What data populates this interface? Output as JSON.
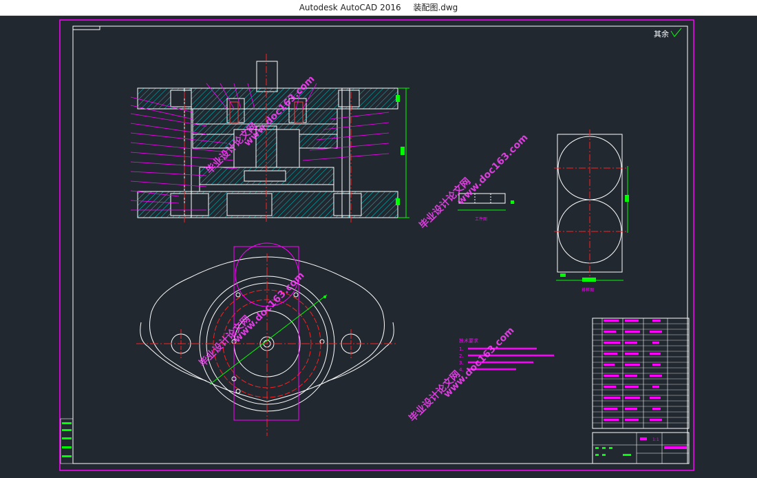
{
  "window": {
    "app_title": "Autodesk AutoCAD 2016",
    "file_name": "装配图.dwg"
  },
  "drawing": {
    "roughness_note": "其余",
    "tech_req_title": "技术要求",
    "tech_req_items": [
      "1.",
      "2.",
      "3.",
      "4."
    ],
    "label_part": "工件图",
    "label_layout": "排样图",
    "scale_text": "1:1",
    "colors": {
      "background": "#212830",
      "frame": "#ff00ff",
      "lines": "#ffffff",
      "hatch": "#00c8c8",
      "center": "#ff2020",
      "dimension": "#00ff00",
      "watermark": "#ff40ff"
    },
    "watermark_texts": [
      "毕业设计论文网",
      "www.doc163.com"
    ]
  }
}
